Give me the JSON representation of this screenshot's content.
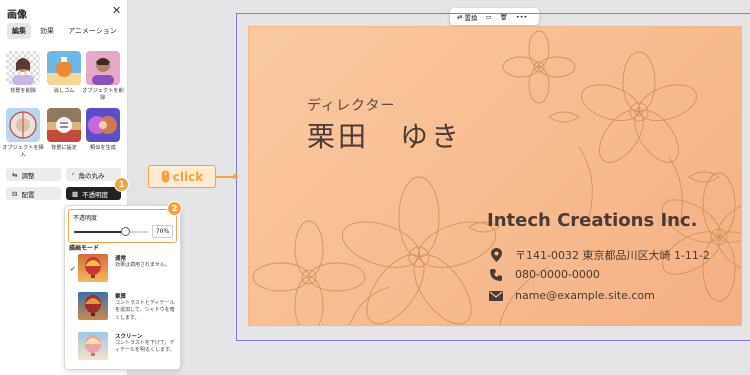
{
  "panel": {
    "title": "画像",
    "tabs": [
      {
        "label": "編集",
        "active": true
      },
      {
        "label": "効果",
        "active": false
      },
      {
        "label": "アニメーション",
        "active": false
      }
    ],
    "tools": [
      {
        "label": "背景を削除",
        "icon": "person-portrait"
      },
      {
        "label": "消しゴム",
        "icon": "eraser-object"
      },
      {
        "label": "オブジェクトを削除",
        "icon": "person-portrait"
      },
      {
        "label": "オブジェクトを挿入",
        "icon": "insert-object"
      },
      {
        "label": "背景に設定",
        "icon": "set-background"
      },
      {
        "label": "類似を生成",
        "icon": "generate-similar"
      }
    ],
    "adjust_label": "調整",
    "corner_label": "角の丸み",
    "arrange_label": "配置",
    "opacity_button_label": "不透明度"
  },
  "popup": {
    "opacity_label": "不透明度",
    "opacity_value": "70%",
    "opacity_level": 0.7,
    "blend_title": "描画モード",
    "modes": [
      {
        "name": "通常",
        "desc": "効果は適用されません。",
        "selected": true
      },
      {
        "name": "乗算",
        "desc": "コントラストとディテールを追加して、シャドウを暗くします。",
        "selected": false
      },
      {
        "name": "スクリーン",
        "desc": "コントラストを下げて、ディテールを明るくします。",
        "selected": false
      }
    ]
  },
  "callouts": {
    "one": "1",
    "two": "2"
  },
  "toolbar": {
    "replace_label": "置換"
  },
  "click_label": "click",
  "card": {
    "role": "ディレクター",
    "name": "栗田　ゆき",
    "company": "Intech Creations Inc.",
    "address": "〒141-0032 東京都品川区大崎 1-11-2",
    "phone": "080-0000-0000",
    "email": "name@example.site.com"
  },
  "colors": {
    "accent": "#f0a640",
    "selection": "#7b7fe0",
    "card_bg": "#f8bd90"
  }
}
